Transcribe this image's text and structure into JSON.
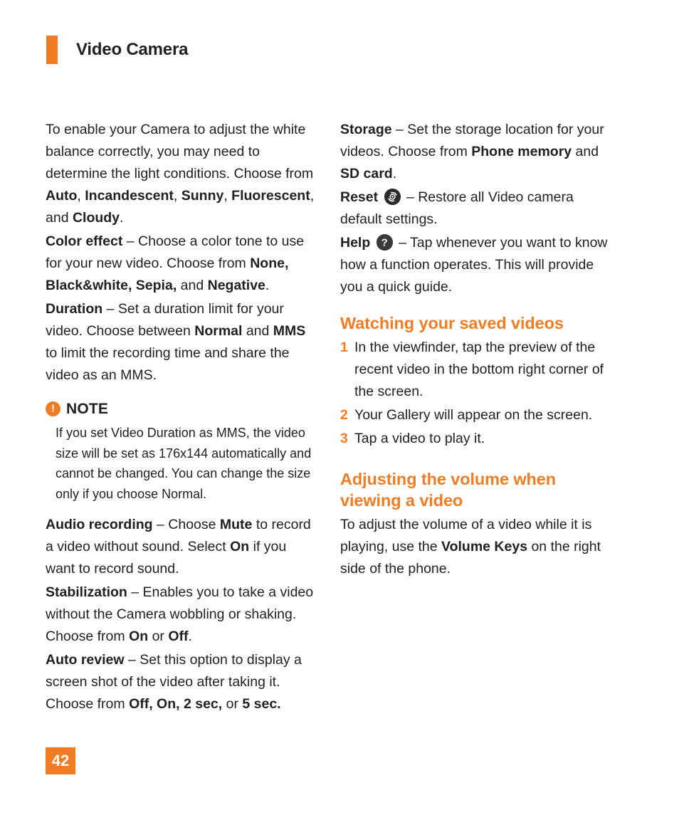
{
  "header": {
    "title": "Video Camera",
    "accent_color": "#F07D23"
  },
  "left_column": {
    "paragraph_white_balance": "To enable your Camera to adjust the white balance correctly, you may need to determine the light conditions. Choose from ",
    "wb_opt1": "Auto",
    "wb_sep1": ", ",
    "wb_opt2": "Incandescent",
    "wb_sep2": ", ",
    "wb_opt3": "Sunny",
    "wb_sep3": ", ",
    "wb_opt4": "Fluorescent",
    "wb_sep4": ", and ",
    "wb_opt5": "Cloudy",
    "wb_end": ".",
    "color_effect_label": "Color effect",
    "color_effect_text": " – Choose a color tone to use for your new video. Choose from ",
    "ce_opt1": "None, Black&white, Sepia,",
    "ce_mid": " and ",
    "ce_opt2": "Negative",
    "ce_end": ".",
    "duration_label": "Duration",
    "duration_text1": " – Set a duration limit for your video. Choose between ",
    "duration_opt1": "Normal",
    "duration_text2": " and ",
    "duration_opt2": "MMS",
    "duration_text3": " to limit the recording time and share the video as an MMS.",
    "note_icon": "exclamation-circle-icon",
    "note_label": "NOTE",
    "note_body": "If you set Video Duration as MMS, the video size will be set as 176x144 automatically and cannot be changed. You can change the size only if you choose Normal.",
    "audio_label": "Audio recording",
    "audio_text1": " – Choose ",
    "audio_opt1": "Mute",
    "audio_text2": " to record a video without sound. Select ",
    "audio_opt2": "On",
    "audio_text3": " if you want to record sound.",
    "stabilization_label": "Stabilization",
    "stabilization_text1": " – Enables you to take a video without the Camera wobbling or shaking. Choose from ",
    "stabilization_opt1": "On",
    "stabilization_text2": " or ",
    "stabilization_opt2": "Off",
    "stabilization_text3": ".",
    "auto_review_label": "Auto review",
    "auto_review_text1": " – Set this option to display a screen shot of the video after taking it. Choose from ",
    "auto_review_opt1": "Off, On, 2 sec,",
    "auto_review_text2": " or ",
    "auto_review_opt2": "5 sec."
  },
  "right_column": {
    "storage_label": "Storage",
    "storage_text1": " – Set the storage location for your videos. Choose from ",
    "storage_opt1": "Phone memory",
    "storage_text2": " and ",
    "storage_opt2": "SD card",
    "storage_text3": ".",
    "reset_label": "Reset",
    "reset_icon": "reset-refresh-icon",
    "reset_text": " – Restore all Video camera default settings.",
    "help_label": "Help",
    "help_icon": "question-mark-icon",
    "help_text": " – Tap whenever you want to know how a function operates. This will provide you a quick guide.",
    "heading_watching": "Watching your saved videos",
    "steps": [
      {
        "num": "1",
        "text": "In the viewfinder, tap the preview of the recent video in the bottom right corner of the screen."
      },
      {
        "num": "2",
        "text": "Your Gallery will appear on the screen."
      },
      {
        "num": "3",
        "text": "Tap a video to play it."
      }
    ],
    "heading_volume": "Adjusting the volume when viewing a video",
    "volume_text1": "To adjust the volume of a video while it is playing, use the ",
    "volume_bold": "Volume Keys",
    "volume_text2": " on the right side of the phone."
  },
  "footer": {
    "page_number": "42"
  }
}
